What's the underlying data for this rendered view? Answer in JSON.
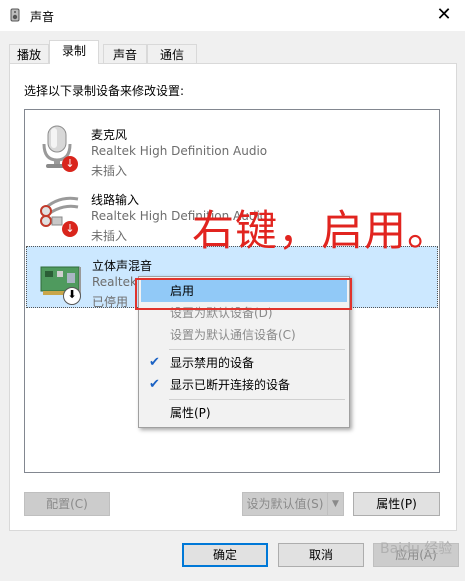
{
  "window": {
    "title": "声音",
    "close_glyph": "✕"
  },
  "tabs": [
    {
      "label": "播放"
    },
    {
      "label": "录制"
    },
    {
      "label": "声音"
    },
    {
      "label": "通信"
    }
  ],
  "instruction": "选择以下录制设备来修改设置:",
  "devices": [
    {
      "name": "麦克风",
      "description": "Realtek High Definition Audio",
      "status": "未插入",
      "icon": "microphone-icon",
      "badge": "unplugged-badge"
    },
    {
      "name": "线路输入",
      "description": "Realtek High Definition Audio",
      "status": "未插入",
      "icon": "line-in-cable-icon",
      "badge": "unplugged-badge"
    },
    {
      "name": "立体声混音",
      "description": "Realtek High Definition Audio",
      "status": "已停用",
      "icon": "sound-card-icon",
      "badge": "disabled-badge"
    }
  ],
  "context_menu": {
    "items": [
      {
        "label": "启用",
        "highlighted": true,
        "disabled": false,
        "checked": false
      },
      {
        "label": "设置为默认设备(D)",
        "highlighted": false,
        "disabled": true,
        "checked": false
      },
      {
        "label": "设置为默认通信设备(C)",
        "highlighted": false,
        "disabled": true,
        "checked": false
      },
      {
        "label": "显示禁用的设备",
        "highlighted": false,
        "disabled": false,
        "checked": true
      },
      {
        "label": "显示已断开连接的设备",
        "highlighted": false,
        "disabled": false,
        "checked": true
      },
      {
        "label": "属性(P)",
        "highlighted": false,
        "disabled": false,
        "checked": false
      }
    ]
  },
  "annotation": "右键，启用。",
  "buttons": {
    "configure": "配置(C)",
    "set_default": "设为默认值(S)",
    "properties": "属性(P)",
    "ok": "确定",
    "cancel": "取消",
    "apply": "应用(A)"
  },
  "watermark": "Baidu 经验",
  "colors": {
    "accent": "#0078d7",
    "selection": "#cce8ff",
    "menu_highlight": "#91c9f7",
    "annotation": "#e1241f",
    "badge_red": "#d9251c"
  }
}
